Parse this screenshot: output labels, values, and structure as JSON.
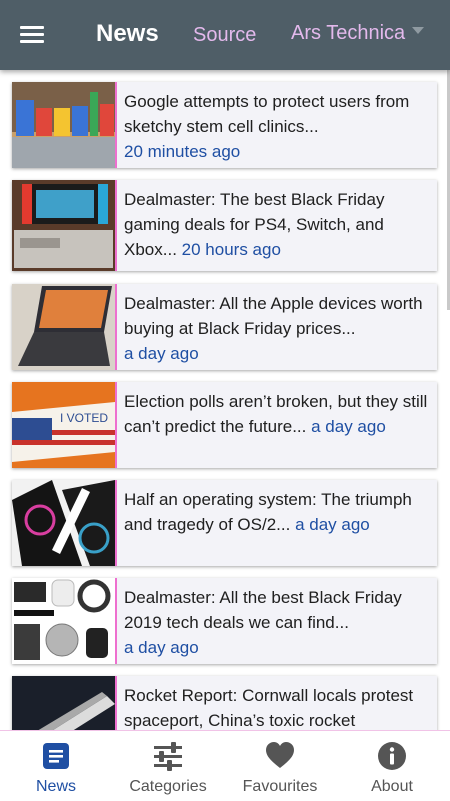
{
  "header": {
    "title": "News",
    "source_label": "Source",
    "source_value": "Ars Technica"
  },
  "articles": [
    {
      "title": "Google attempts to protect users from sketchy stem cell clinics...",
      "time": "20 minutes ago",
      "thumb": "google-sign-image"
    },
    {
      "title": "Dealmaster: The best Black Friday gaming deals for PS4, Switch, and Xbox...",
      "time": "20 hours ago",
      "thumb": "game-consoles-image"
    },
    {
      "title": "Dealmaster: All the Apple devices worth buying at Black Friday prices...",
      "time": "a day ago",
      "thumb": "ipad-keyboard-image"
    },
    {
      "title": "Election polls aren’t broken, but they still can’t predict the future...",
      "time": "a day ago",
      "thumb": "i-voted-sticker-image"
    },
    {
      "title": "Half an operating system: The triumph and tragedy of OS/2...",
      "time": "a day ago",
      "thumb": "os2-discs-image"
    },
    {
      "title": "Dealmaster: All the best Black Friday 2019 tech deals we can find...",
      "time": "a day ago",
      "thumb": "tech-gadgets-image"
    },
    {
      "title": "Rocket Report: Cornwall locals protest spaceport, China’s toxic rocket",
      "time": "",
      "thumb": "rocket-image"
    }
  ],
  "nav": [
    {
      "label": "News",
      "icon": "news-icon",
      "active": true
    },
    {
      "label": "Categories",
      "icon": "sliders-icon",
      "active": false
    },
    {
      "label": "Favourites",
      "icon": "heart-icon",
      "active": false
    },
    {
      "label": "About",
      "icon": "info-icon",
      "active": false
    }
  ],
  "colors": {
    "header_bg": "#4f5e67",
    "accent_pink": "#e3b9ec",
    "link_blue": "#1f4fa3",
    "thumb_border": "#ee6fcf"
  }
}
